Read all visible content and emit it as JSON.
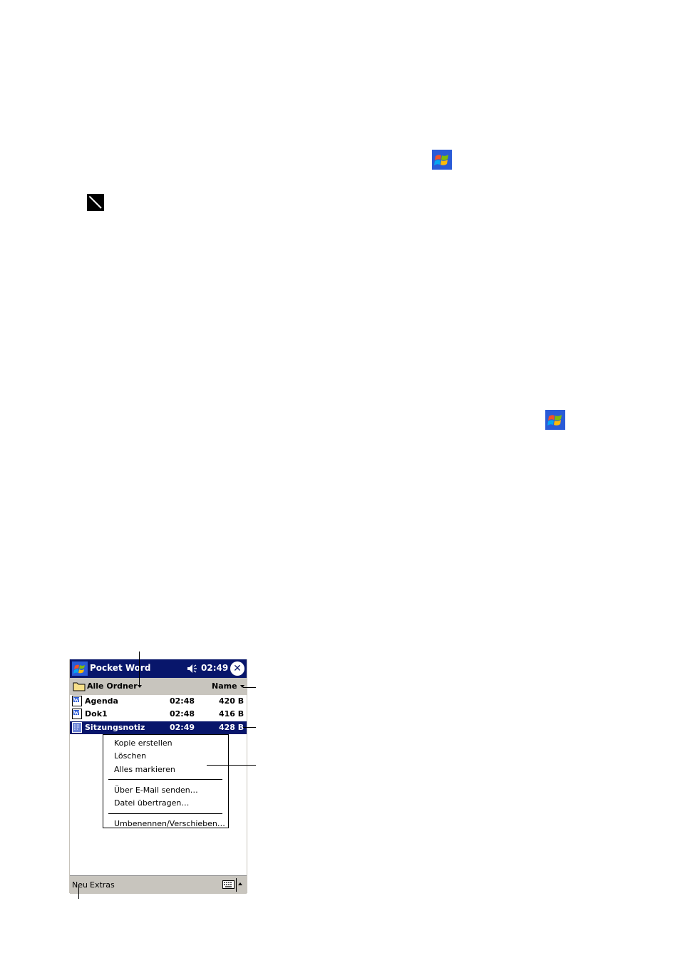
{
  "title_bar": {
    "app_title": "Pocket Word",
    "time": "02:49",
    "close_symbol": "✕"
  },
  "filter_bar": {
    "folder_label": "Alle Ordner",
    "sort_label": "Name"
  },
  "files": [
    {
      "name": "Agenda",
      "time": "02:48",
      "size": "420 B",
      "icon": "word-doc-icon"
    },
    {
      "name": "Dok1",
      "time": "02:48",
      "size": "416 B",
      "icon": "word-doc-icon"
    },
    {
      "name": "Sitzungsnotiz",
      "time": "02:49",
      "size": "428 B",
      "icon": "note-doc-icon",
      "selected": true
    }
  ],
  "context_menu": {
    "items": [
      "Kopie erstellen",
      "Löschen",
      "Alles markieren",
      "Über E-Mail senden…",
      "Datei übertragen…",
      "Umbenennen/Verschieben…"
    ]
  },
  "bottom_bar": {
    "new_label": "Neu",
    "tools_label": "Extras"
  },
  "colors": {
    "title_bar": "#08166b",
    "bars": "#c8c5be",
    "selection": "#08166b"
  }
}
